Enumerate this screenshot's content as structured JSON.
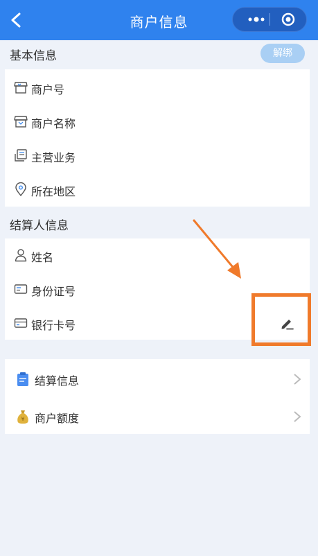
{
  "header": {
    "title": "商户信息"
  },
  "basic": {
    "title": "基本信息",
    "unbind_label": "解绑",
    "items": [
      {
        "label": "商户号",
        "icon": "store-icon"
      },
      {
        "label": "商户名称",
        "icon": "store-icon"
      },
      {
        "label": "主营业务",
        "icon": "business-card-icon"
      },
      {
        "label": "所在地区",
        "icon": "location-pin-icon"
      }
    ]
  },
  "settler": {
    "title": "结算人信息",
    "items": [
      {
        "label": "姓名",
        "icon": "person-icon"
      },
      {
        "label": "身份证号",
        "icon": "id-card-icon"
      },
      {
        "label": "银行卡号",
        "icon": "bank-card-icon"
      }
    ]
  },
  "links": [
    {
      "label": "结算信息",
      "icon": "document-icon"
    },
    {
      "label": "商户额度",
      "icon": "money-bag-icon"
    }
  ],
  "colors": {
    "header": "#2f82ee",
    "background": "#eef2f9",
    "annotation": "#f07a2b",
    "unbind_button": "#a9cff4"
  }
}
